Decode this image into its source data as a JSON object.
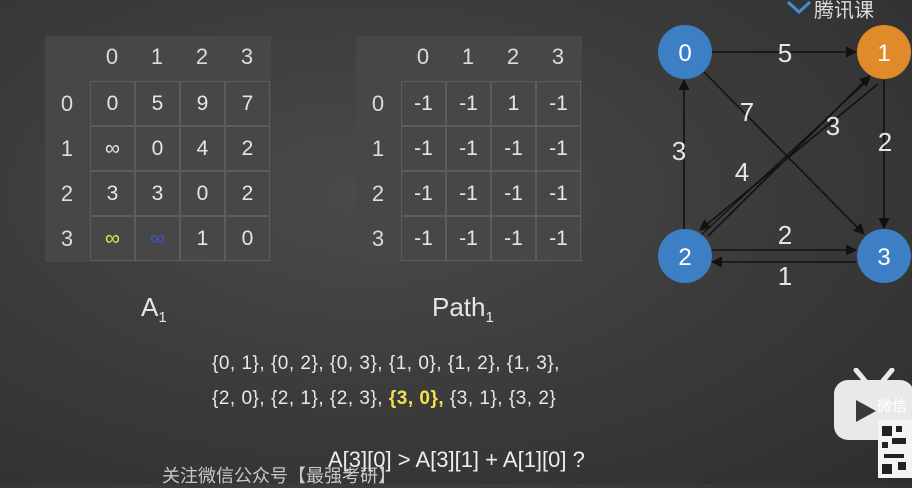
{
  "matrix_a": {
    "col_headers": [
      "0",
      "1",
      "2",
      "3"
    ],
    "row_headers": [
      "0",
      "1",
      "2",
      "3"
    ],
    "cells": [
      [
        {
          "v": "0",
          "c": ""
        },
        {
          "v": "5",
          "c": ""
        },
        {
          "v": "9",
          "c": ""
        },
        {
          "v": "7",
          "c": ""
        }
      ],
      [
        {
          "v": "∞",
          "c": ""
        },
        {
          "v": "0",
          "c": ""
        },
        {
          "v": "4",
          "c": ""
        },
        {
          "v": "2",
          "c": ""
        }
      ],
      [
        {
          "v": "3",
          "c": ""
        },
        {
          "v": "3",
          "c": ""
        },
        {
          "v": "0",
          "c": ""
        },
        {
          "v": "2",
          "c": ""
        }
      ],
      [
        {
          "v": "∞",
          "c": "yellow"
        },
        {
          "v": "∞",
          "c": "blue"
        },
        {
          "v": "1",
          "c": ""
        },
        {
          "v": "0",
          "c": ""
        }
      ]
    ],
    "caption_main": "A",
    "caption_sub": "1"
  },
  "matrix_path": {
    "col_headers": [
      "0",
      "1",
      "2",
      "3"
    ],
    "row_headers": [
      "0",
      "1",
      "2",
      "3"
    ],
    "cells": [
      [
        {
          "v": "-1",
          "c": ""
        },
        {
          "v": "-1",
          "c": ""
        },
        {
          "v": "1",
          "c": ""
        },
        {
          "v": "-1",
          "c": ""
        }
      ],
      [
        {
          "v": "-1",
          "c": ""
        },
        {
          "v": "-1",
          "c": ""
        },
        {
          "v": "-1",
          "c": ""
        },
        {
          "v": "-1",
          "c": ""
        }
      ],
      [
        {
          "v": "-1",
          "c": ""
        },
        {
          "v": "-1",
          "c": ""
        },
        {
          "v": "-1",
          "c": ""
        },
        {
          "v": "-1",
          "c": ""
        }
      ],
      [
        {
          "v": "-1",
          "c": ""
        },
        {
          "v": "-1",
          "c": ""
        },
        {
          "v": "-1",
          "c": ""
        },
        {
          "v": "-1",
          "c": ""
        }
      ]
    ],
    "caption_main": "Path",
    "caption_sub": "1"
  },
  "graph": {
    "nodes": [
      {
        "label": "0",
        "color": "#3d7fc4"
      },
      {
        "label": "1",
        "color": "#e08a2a"
      },
      {
        "label": "2",
        "color": "#3d7fc4"
      },
      {
        "label": "3",
        "color": "#3d7fc4"
      }
    ],
    "edge_labels": {
      "e01": "5",
      "e03": "7",
      "e21_top": "3",
      "e13": "2",
      "e20": "3",
      "e12": "4",
      "e23": "2",
      "e32": "1"
    }
  },
  "pairs": {
    "line1": [
      "{0,  1},",
      "{0,  2},",
      "{0,  3},",
      "{1,  0},",
      "{1,  2},",
      "{1,  3},"
    ],
    "line2_before": [
      "{2,  0},",
      "{2,  1},",
      "{2,  3},"
    ],
    "line2_highlight": "{3,  0},",
    "line2_after": [
      "{3,  1},",
      "{3,  2}"
    ]
  },
  "question": "A[3][0] > A[3][1] + A[1][0] ?",
  "watermark": "关注微信公众号【最强考研】",
  "brand": "腾讯课",
  "bili_text": "微信",
  "colors": {
    "node_blue": "#3d7fc4",
    "node_orange": "#e08a2a",
    "highlight_yellow": "#f1e24a",
    "infinity_blue": "#3f55c9"
  }
}
